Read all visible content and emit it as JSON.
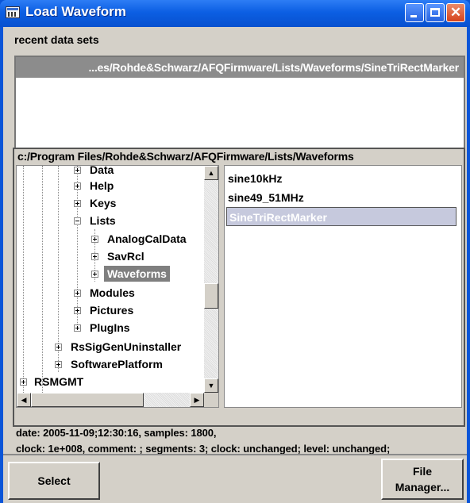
{
  "window": {
    "title": "Load Waveform"
  },
  "recent": {
    "label": "recent data sets",
    "items": [
      "...es/Rohde&Schwarz/AFQFirmware/Lists/Waveforms/SineTriRectMarker"
    ]
  },
  "browser": {
    "path": "c:/Program Files/Rohde&Schwarz/AFQFirmware/Lists/Waveforms",
    "tree": [
      {
        "label": "Data"
      },
      {
        "label": "Help"
      },
      {
        "label": "Keys"
      },
      {
        "label": "Lists"
      },
      {
        "label": "AnalogCalData"
      },
      {
        "label": "SavRcl"
      },
      {
        "label": "Waveforms"
      },
      {
        "label": "Modules"
      },
      {
        "label": "Pictures"
      },
      {
        "label": "PlugIns"
      },
      {
        "label": "RsSigGenUninstaller"
      },
      {
        "label": "SoftwarePlatform"
      },
      {
        "label": "RSMGMT"
      }
    ],
    "selected_folder": "Waveforms",
    "files": [
      "sine10kHz",
      "sine49_51MHz",
      "SineTriRectMarker"
    ],
    "selected_file": "SineTriRectMarker"
  },
  "info": {
    "line1": "date: 2005-11-09;12:30:16, samples: 1800,",
    "line2": "clock: 1e+008, comment: ; segments: 3; clock: unchanged; level: unchanged;"
  },
  "buttons": {
    "select": "Select",
    "file_manager_line1": "File",
    "file_manager_line2": "Manager..."
  },
  "colors": {
    "titlebar": "#0c5fe3",
    "panel": "#d4d0c8",
    "selection": "#8c8c8c",
    "file_selection": "#c6c9dd"
  }
}
